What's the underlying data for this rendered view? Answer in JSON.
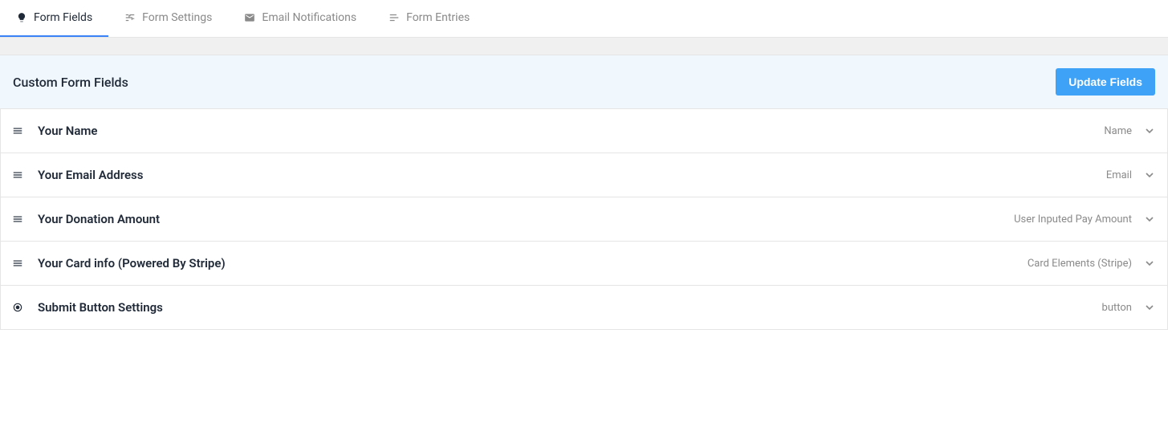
{
  "tabs": [
    {
      "label": "Form Fields",
      "icon": "lightbulb-icon",
      "active": true
    },
    {
      "label": "Form Settings",
      "icon": "sliders-icon",
      "active": false
    },
    {
      "label": "Email Notifications",
      "icon": "mail-icon",
      "active": false
    },
    {
      "label": "Form Entries",
      "icon": "list-icon",
      "active": false
    }
  ],
  "section": {
    "title": "Custom Form Fields",
    "update_button": "Update Fields"
  },
  "fields": [
    {
      "label": "Your Name",
      "type": "Name",
      "icon": "drag"
    },
    {
      "label": "Your Email Address",
      "type": "Email",
      "icon": "drag"
    },
    {
      "label": "Your Donation Amount",
      "type": "User Inputed Pay Amount",
      "icon": "drag"
    },
    {
      "label": "Your Card info (Powered By Stripe)",
      "type": "Card Elements (Stripe)",
      "icon": "drag"
    },
    {
      "label": "Submit Button Settings",
      "type": "button",
      "icon": "target"
    }
  ]
}
